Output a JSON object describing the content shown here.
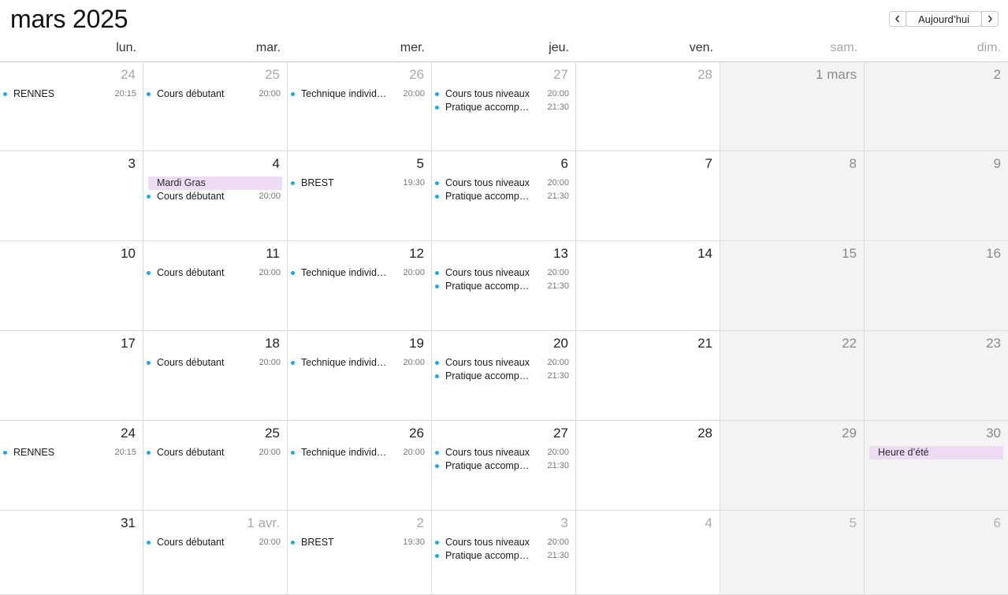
{
  "header": {
    "title": "mars 2025",
    "today_label": "Aujourd’hui",
    "prev_icon": "chevron-left-icon",
    "next_icon": "chevron-right-icon"
  },
  "weekdays": [
    {
      "label": "lun.",
      "weekend": false
    },
    {
      "label": "mar.",
      "weekend": false
    },
    {
      "label": "mer.",
      "weekend": false
    },
    {
      "label": "jeu.",
      "weekend": false
    },
    {
      "label": "ven.",
      "weekend": false
    },
    {
      "label": "sam.",
      "weekend": true
    },
    {
      "label": "dim.",
      "weekend": true
    }
  ],
  "colors": {
    "event_dot": "#1ea6ee",
    "allday_bg": "#eedcf5",
    "weekend_bg": "#f3f3f3"
  },
  "weeks": [
    [
      {
        "day": "24",
        "other": true,
        "events": [
          {
            "title": "RENNES",
            "time": "20:15"
          }
        ]
      },
      {
        "day": "25",
        "other": true,
        "events": [
          {
            "title": "Cours débutant",
            "time": "20:00"
          }
        ]
      },
      {
        "day": "26",
        "other": true,
        "events": [
          {
            "title": "Technique individuelle",
            "time": "20:00"
          }
        ]
      },
      {
        "day": "27",
        "other": true,
        "events": [
          {
            "title": "Cours tous niveaux",
            "time": "20:00"
          },
          {
            "title": "Pratique accompagnée",
            "time": "21:30"
          }
        ]
      },
      {
        "day": "28",
        "other": true,
        "events": []
      },
      {
        "day": "1 mars",
        "other": false,
        "events": []
      },
      {
        "day": "2",
        "other": false,
        "events": []
      }
    ],
    [
      {
        "day": "3",
        "other": false,
        "events": []
      },
      {
        "day": "4",
        "other": false,
        "events": [
          {
            "title": "Mardi Gras",
            "allday": true
          },
          {
            "title": "Cours débutant",
            "time": "20:00"
          }
        ]
      },
      {
        "day": "5",
        "other": false,
        "events": [
          {
            "title": "BREST",
            "time": "19:30"
          }
        ]
      },
      {
        "day": "6",
        "other": false,
        "events": [
          {
            "title": "Cours tous niveaux",
            "time": "20:00"
          },
          {
            "title": "Pratique accompagnée",
            "time": "21:30"
          }
        ]
      },
      {
        "day": "7",
        "other": false,
        "events": []
      },
      {
        "day": "8",
        "other": false,
        "events": []
      },
      {
        "day": "9",
        "other": false,
        "events": []
      }
    ],
    [
      {
        "day": "10",
        "other": false,
        "events": []
      },
      {
        "day": "11",
        "other": false,
        "events": [
          {
            "title": "Cours débutant",
            "time": "20:00"
          }
        ]
      },
      {
        "day": "12",
        "other": false,
        "events": [
          {
            "title": "Technique individuelle",
            "time": "20:00"
          }
        ]
      },
      {
        "day": "13",
        "other": false,
        "events": [
          {
            "title": "Cours tous niveaux",
            "time": "20:00"
          },
          {
            "title": "Pratique accompagnée",
            "time": "21:30"
          }
        ]
      },
      {
        "day": "14",
        "other": false,
        "events": []
      },
      {
        "day": "15",
        "other": false,
        "events": []
      },
      {
        "day": "16",
        "other": false,
        "events": []
      }
    ],
    [
      {
        "day": "17",
        "other": false,
        "events": []
      },
      {
        "day": "18",
        "other": false,
        "events": [
          {
            "title": "Cours débutant",
            "time": "20:00"
          }
        ]
      },
      {
        "day": "19",
        "other": false,
        "events": [
          {
            "title": "Technique individuelle",
            "time": "20:00"
          }
        ]
      },
      {
        "day": "20",
        "other": false,
        "events": [
          {
            "title": "Cours tous niveaux",
            "time": "20:00"
          },
          {
            "title": "Pratique accompagnée",
            "time": "21:30"
          }
        ]
      },
      {
        "day": "21",
        "other": false,
        "events": []
      },
      {
        "day": "22",
        "other": false,
        "events": []
      },
      {
        "day": "23",
        "other": false,
        "events": []
      }
    ],
    [
      {
        "day": "24",
        "other": false,
        "events": [
          {
            "title": "RENNES",
            "time": "20:15"
          }
        ]
      },
      {
        "day": "25",
        "other": false,
        "events": [
          {
            "title": "Cours débutant",
            "time": "20:00"
          }
        ]
      },
      {
        "day": "26",
        "other": false,
        "events": [
          {
            "title": "Technique individuelle",
            "time": "20:00"
          }
        ]
      },
      {
        "day": "27",
        "other": false,
        "events": [
          {
            "title": "Cours tous niveaux",
            "time": "20:00"
          },
          {
            "title": "Pratique accompagnée",
            "time": "21:30"
          }
        ]
      },
      {
        "day": "28",
        "other": false,
        "events": []
      },
      {
        "day": "29",
        "other": false,
        "events": []
      },
      {
        "day": "30",
        "other": false,
        "events": [
          {
            "title": "Heure d’été",
            "allday": true
          }
        ]
      }
    ],
    [
      {
        "day": "31",
        "other": false,
        "events": []
      },
      {
        "day": "1 avr.",
        "other": true,
        "events": [
          {
            "title": "Cours débutant",
            "time": "20:00"
          }
        ]
      },
      {
        "day": "2",
        "other": true,
        "events": [
          {
            "title": "BREST",
            "time": "19:30"
          }
        ]
      },
      {
        "day": "3",
        "other": true,
        "events": [
          {
            "title": "Cours tous niveaux",
            "time": "20:00"
          },
          {
            "title": "Pratique accompagnée",
            "time": "21:30"
          }
        ]
      },
      {
        "day": "4",
        "other": true,
        "events": []
      },
      {
        "day": "5",
        "other": true,
        "events": []
      },
      {
        "day": "6",
        "other": true,
        "events": []
      }
    ]
  ]
}
